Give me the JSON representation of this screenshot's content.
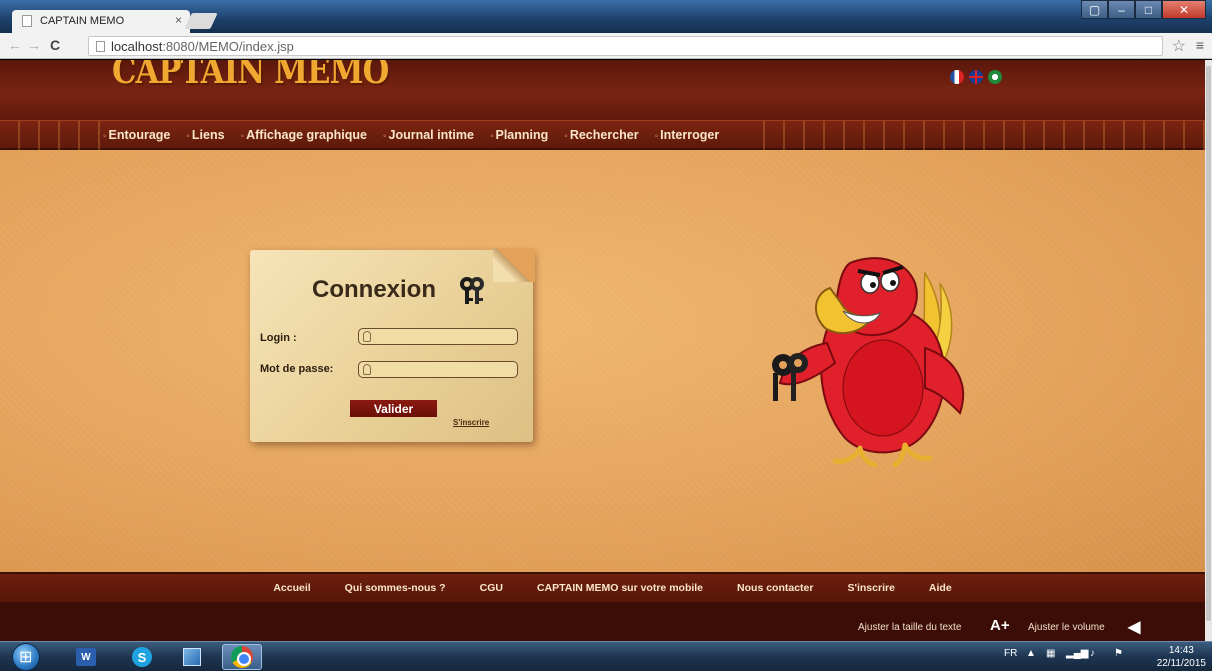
{
  "browser": {
    "tab_title": "CAPTAIN MEMO",
    "tab_close": "×",
    "url_host": "localhost",
    "url_rest": ":8080/MEMO/index.jsp"
  },
  "header": {
    "logo": "CAPTAIN MEMO",
    "languages": [
      "fr",
      "en",
      "ar"
    ]
  },
  "nav": {
    "items": [
      "Entourage",
      "Liens",
      "Affichage graphique",
      "Journal intime",
      "Planning",
      "Rechercher",
      "Interroger"
    ]
  },
  "login": {
    "title": "Connexion",
    "login_label": "Login :",
    "password_label": "Mot de passe:",
    "login_value": "",
    "password_value": "",
    "submit_label": "Valider",
    "signup_link": "S'inscrire"
  },
  "footer": {
    "items": [
      "Accueil",
      "Qui sommes-nous ?",
      "CGU",
      "CAPTAIN MEMO sur votre mobile",
      "Nous contacter",
      "S'inscrire",
      "Aide"
    ],
    "text_size_label": "Ajuster la taille du texte",
    "text_size_icon": "A+",
    "volume_label": "Ajuster le volume"
  },
  "taskbar": {
    "apps": [
      "start-button",
      "word",
      "skype",
      "virtualbox",
      "chrome"
    ],
    "active_app": "chrome",
    "language": "FR",
    "time": "14:43",
    "date": "22/11/2015"
  },
  "colors": {
    "header_dark": "#5a170c",
    "content_bg": "#e3a15a",
    "button_red": "#8a1a10",
    "nav_text": "#fbe6c8"
  }
}
